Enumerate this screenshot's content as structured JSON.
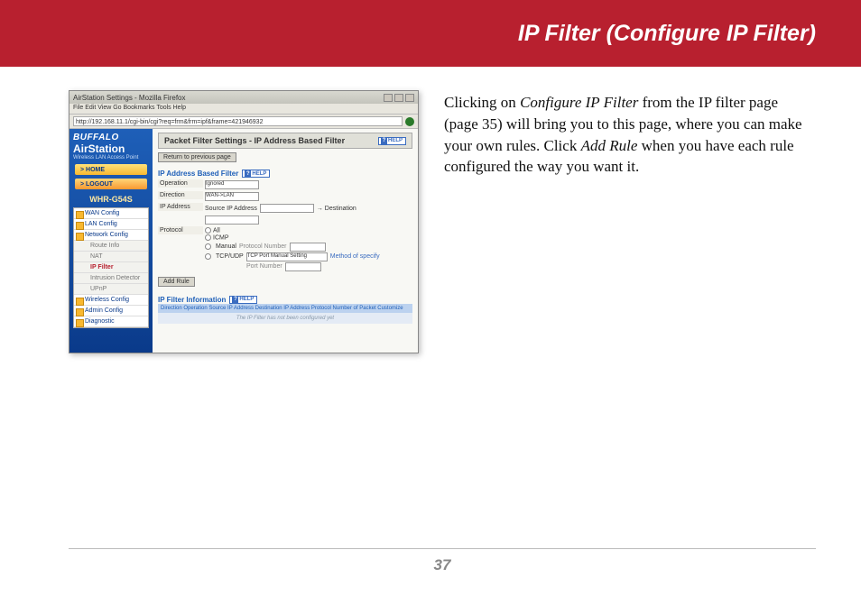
{
  "header": {
    "title": "IP Filter (Configure IP Filter)"
  },
  "body_text": {
    "t1": "Clicking on ",
    "i1": "Configure IP Filter",
    "t2": " from the IP filter page (page 35) will bring you to this page, where you can make your own rules. Click ",
    "i2": "Add Rule",
    "t3": " when you have each rule configured the way you want it."
  },
  "footer": {
    "page_number": "37"
  },
  "screenshot": {
    "window_title": "AirStation Settings - Mozilla Firefox",
    "menubar": "File  Edit  View  Go  Bookmarks  Tools  Help",
    "address": "http://192.168.11.1/cgi-bin/cgi?req=frm&frm=ipf&frame=421946932",
    "logo": {
      "brand1": "BUFFALO",
      "brand2": "AirStation",
      "brand3": "Wireless LAN Access Point"
    },
    "nav_home": "> HOME",
    "nav_logout": "> LOGOUT",
    "model": "WHR-G54S",
    "menu": {
      "wan": "WAN Config",
      "lan": "LAN Config",
      "net": "Network Config",
      "route": "Route Info",
      "nat": "NAT",
      "ipfilter": "IP Filter",
      "intrusion": "Intrusion Detector",
      "upnp": "UPnP",
      "wireless": "Wireless Config",
      "admin": "Admin Config",
      "diag": "Diagnostic"
    },
    "panel_title": "Packet Filter Settings - IP Address Based Filter",
    "help_label": "HELP",
    "return_btn": "Return to previous page",
    "section_filter": "IP Address Based Filter",
    "form": {
      "operation_label": "Operation",
      "operation_value": "Ignored",
      "direction_label": "Direction",
      "direction_value": "WAN->LAN",
      "ip_label": "IP Address",
      "ip_source": "Source IP Address",
      "ip_dest": "→ Destination",
      "protocol_label": "Protocol",
      "proto_all": "All",
      "proto_icmp": "ICMP",
      "proto_manual": "Manual",
      "proto_manual_hint": "Protocol Number",
      "proto_tcpudp": "TCP/UDP",
      "port_setting": "TCP Port Manual Setting",
      "port_method": "Method of specify",
      "port_number": "Port Number"
    },
    "add_rule_btn": "Add Rule",
    "section_info": "IP Filter Information",
    "info_header": "Direction Operation Source IP Address Destination IP Address Protocol Number of Packet Customize",
    "info_empty": "The IP Filter has not been configured yet"
  }
}
